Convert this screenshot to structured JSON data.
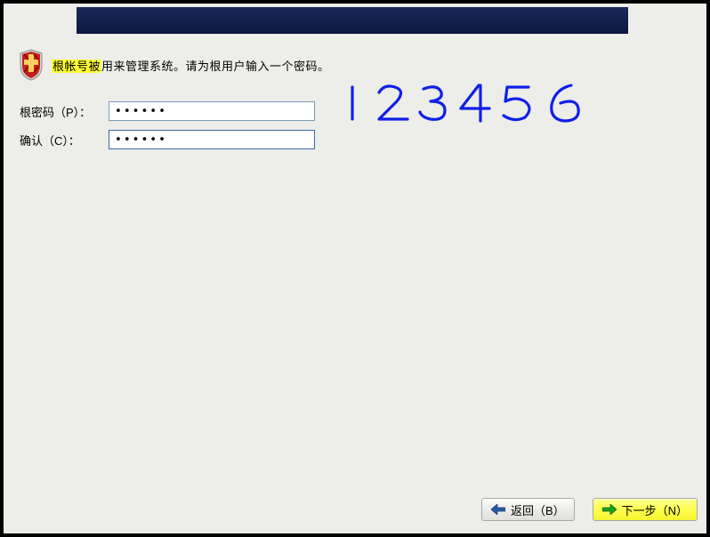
{
  "intro": {
    "highlighted": "根帐号被",
    "rest": "用来管理系统。请为根用户输入一个密码。"
  },
  "form": {
    "password_label": "根密码（P）：",
    "password_value": "••••••",
    "confirm_label": "确认（C）：",
    "confirm_value": "••••••"
  },
  "annotation": {
    "text": "123456"
  },
  "buttons": {
    "back_label": "返回（B）",
    "next_label": "下一步（N）"
  }
}
